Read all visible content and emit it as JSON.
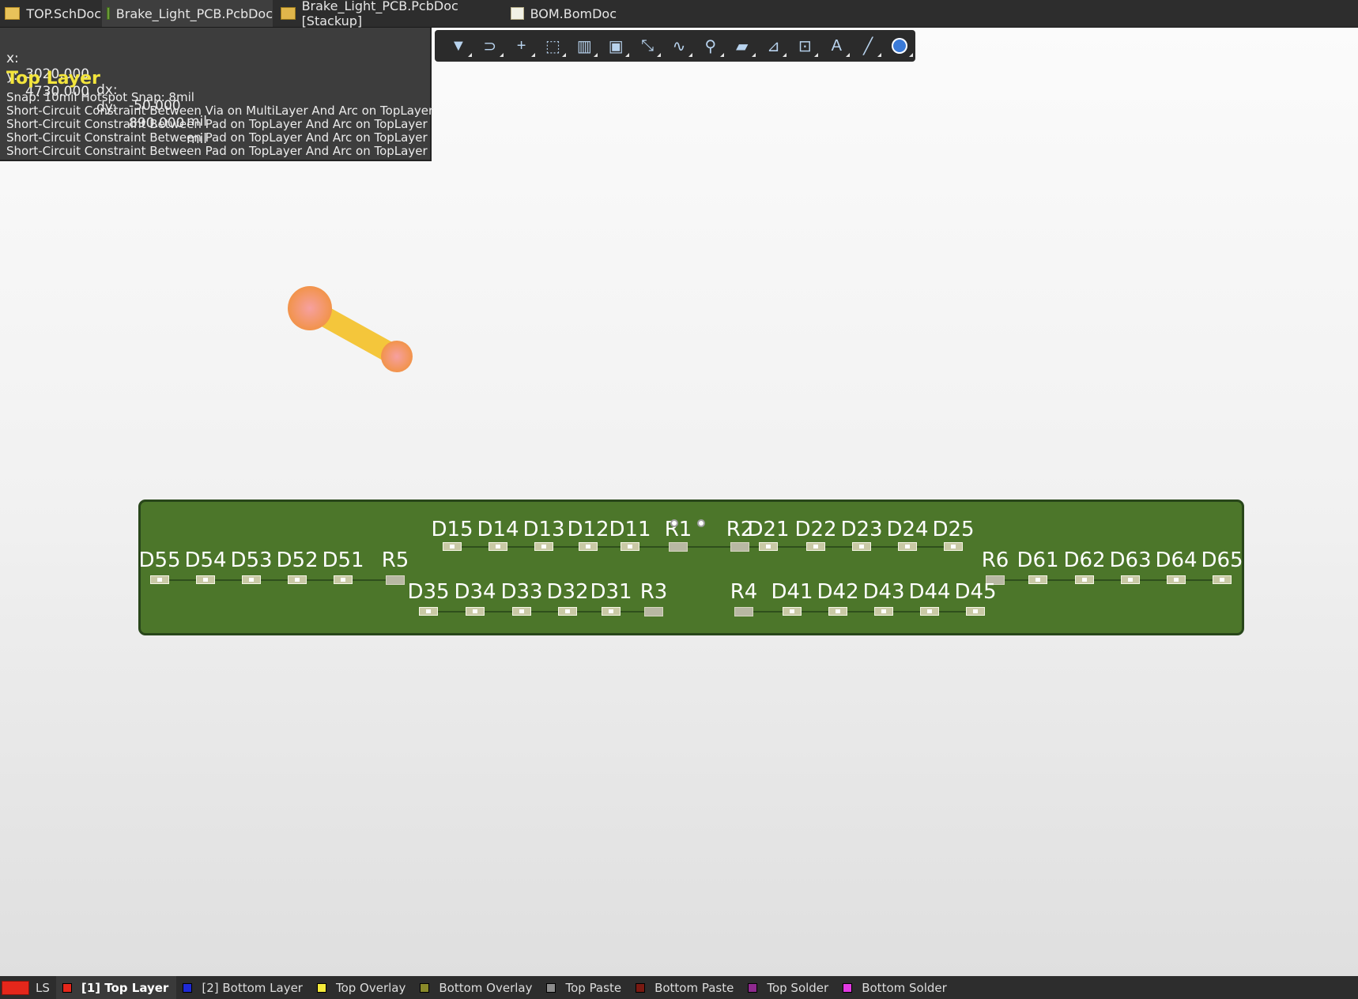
{
  "tabs": [
    {
      "label": "TOP.SchDoc",
      "icon": "schematic-doc-icon"
    },
    {
      "label": "Brake_Light_PCB.PcbDoc",
      "icon": "pcb-doc-icon",
      "active": true
    },
    {
      "label": "Brake_Light_PCB.PcbDoc [Stackup]",
      "icon": "stackup-doc-icon"
    },
    {
      "label": "BOM.BomDoc",
      "icon": "bom-doc-icon"
    }
  ],
  "hud": {
    "x_label": "x:",
    "x_value": "3020.000",
    "dx_label": "dx:",
    "dx_value": "-50.000",
    "y_label": "y:",
    "y_value": "4730.000",
    "dy_label": "dy:",
    "dy_value": "890.000",
    "unit": "mil",
    "layer": "Top Layer",
    "snap": "Snap: 10mil Hotspot Snap: 8mil",
    "violations": [
      "Short-Circuit Constraint Between Via on MultiLayer And Arc on TopLayer",
      "Short-Circuit Constraint Between Pad on TopLayer And Arc on TopLayer",
      "Short-Circuit Constraint Between Pad on TopLayer And Arc on TopLayer",
      "Short-Circuit Constraint Between Pad on TopLayer And Arc on TopLayer"
    ]
  },
  "toolbar": {
    "buttons": [
      {
        "name": "filter-icon",
        "glyph": "▼"
      },
      {
        "name": "interactive-routing-icon",
        "glyph": "⊃"
      },
      {
        "name": "add-icon",
        "glyph": "+"
      },
      {
        "name": "select-rectangle-icon",
        "glyph": "⬚"
      },
      {
        "name": "align-icon",
        "glyph": "▥"
      },
      {
        "name": "component-icon",
        "glyph": "▣"
      },
      {
        "name": "route-icon",
        "glyph": "⤡"
      },
      {
        "name": "length-tuning-icon",
        "glyph": "∿"
      },
      {
        "name": "place-pad-icon",
        "glyph": "⚲"
      },
      {
        "name": "polygon-icon",
        "glyph": "▰"
      },
      {
        "name": "dimension-icon",
        "glyph": "⊿"
      },
      {
        "name": "text-frame-icon",
        "glyph": "⊡"
      },
      {
        "name": "string-icon",
        "glyph": "A"
      },
      {
        "name": "line-icon",
        "glyph": "╱"
      },
      {
        "name": "3d-body-icon",
        "glyph": ""
      }
    ]
  },
  "board": {
    "row1_refs": [
      "D15",
      "D14",
      "D13",
      "D12",
      "D11",
      "R1",
      "R2",
      "D21",
      "D22",
      "D23",
      "D24",
      "D25"
    ],
    "row2_refs": [
      "D55",
      "D54",
      "D53",
      "D52",
      "D51",
      "R5",
      "R6",
      "D61",
      "D62",
      "D63",
      "D64",
      "D65"
    ],
    "row3_refs": [
      "D35",
      "D34",
      "D33",
      "D32",
      "D31",
      "R3",
      "R4",
      "D41",
      "D42",
      "D43",
      "D44",
      "D45"
    ]
  },
  "layers": {
    "ls": "LS",
    "tabs": [
      {
        "label": "[1] Top Layer",
        "color": "#e5271b",
        "active": true
      },
      {
        "label": "[2] Bottom Layer",
        "color": "#1f2ad6"
      },
      {
        "label": "Top Overlay",
        "color": "#f4ea3a"
      },
      {
        "label": "Bottom Overlay",
        "color": "#8a8a2a"
      },
      {
        "label": "Top Paste",
        "color": "#8c8c8c"
      },
      {
        "label": "Bottom Paste",
        "color": "#7a1a12"
      },
      {
        "label": "Top Solder",
        "color": "#8f2a8f"
      },
      {
        "label": "Bottom Solder",
        "color": "#e23ae2"
      }
    ]
  }
}
